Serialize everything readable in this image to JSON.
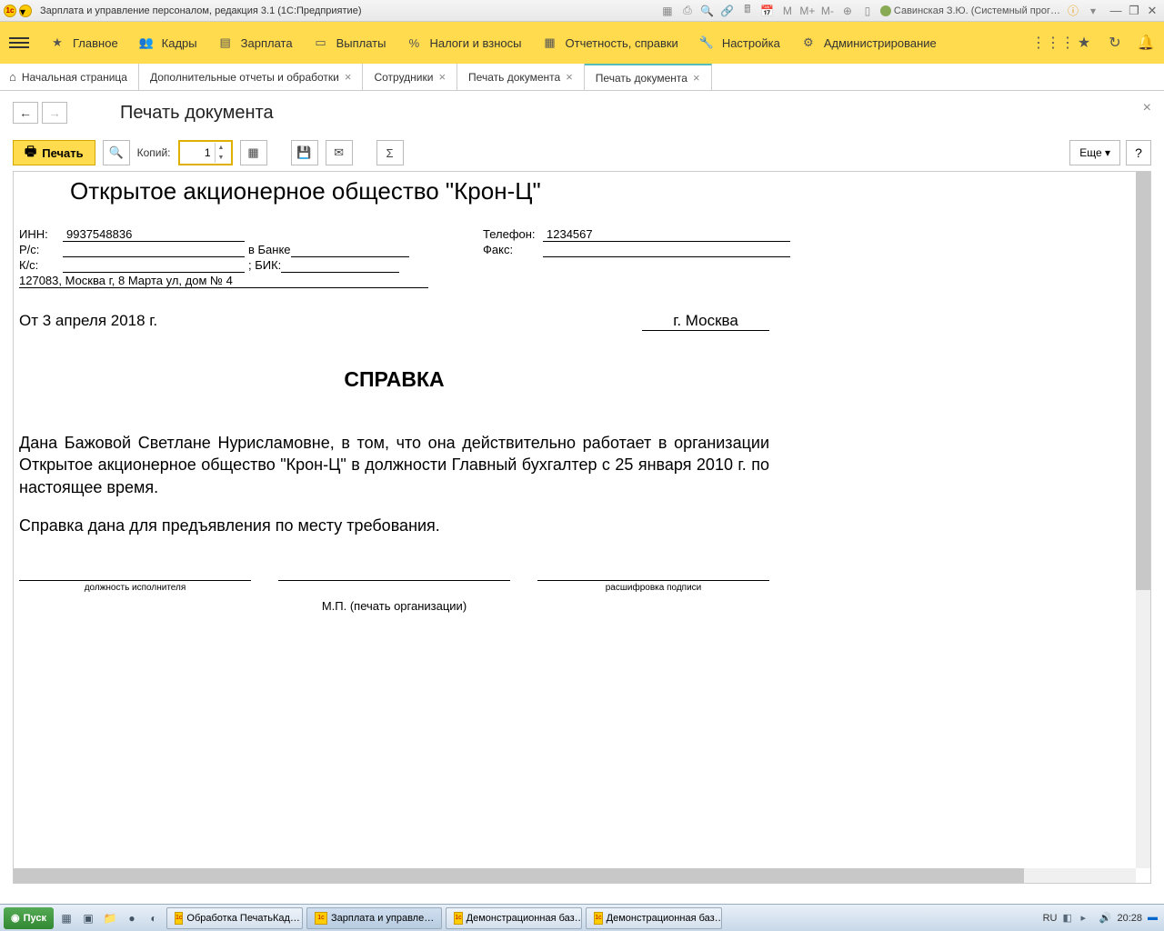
{
  "titlebar": {
    "title": "Зарплата и управление персоналом, редакция 3.1  (1С:Предприятие)",
    "user": "Савинская З.Ю. (Системный прог…"
  },
  "nav": {
    "items": [
      "Главное",
      "Кадры",
      "Зарплата",
      "Выплаты",
      "Налоги и взносы",
      "Отчетность, справки",
      "Настройка",
      "Администрирование"
    ]
  },
  "tabs": {
    "home": "Начальная страница",
    "items": [
      {
        "label": "Дополнительные отчеты и обработки"
      },
      {
        "label": "Сотрудники"
      },
      {
        "label": "Печать документа"
      },
      {
        "label": "Печать документа",
        "active": true
      }
    ]
  },
  "page": {
    "title": "Печать документа"
  },
  "toolbar": {
    "print": "Печать",
    "copies_label": "Копий:",
    "copies_value": "1",
    "more": "Еще",
    "help": "?"
  },
  "doc": {
    "company": "Открытое акционерное общество \"Крон-Ц\"",
    "inn_label": "ИНН:",
    "inn": "9937548836",
    "rs_label": "Р/с:",
    "rs_bank": "в Банке",
    "ks_label": "К/с:",
    "ks_bik": "; БИК:",
    "address": "127083, Москва г, 8 Марта ул, дом № 4",
    "tel_label": "Телефон:",
    "tel": "1234567",
    "fax_label": "Факс:",
    "date": "От 3 апреля 2018 г.",
    "city": "г. Москва",
    "heading": "СПРАВКА",
    "body1": "Дана Бажовой Светлане Нурисламовне,  в том, что она действительно работает в организации Открытое акционерное общество \"Крон-Ц\" в должности Главный бухгалтер с 25 января 2010 г. по настоящее время.",
    "body2": "Справка дана для предъявления по месту требования.",
    "sig1": "должность исполнителя",
    "sig2": "расшифровка подписи",
    "stamp": "М.П. (печать организации)"
  },
  "taskbar": {
    "start": "Пуск",
    "tasks": [
      {
        "label": "Обработка ПечатьКад…"
      },
      {
        "label": "Зарплата и управле…",
        "active": true
      },
      {
        "label": "Демонстрационная баз…"
      },
      {
        "label": "Демонстрационная баз…"
      }
    ],
    "lang": "RU",
    "time": "20:28"
  }
}
